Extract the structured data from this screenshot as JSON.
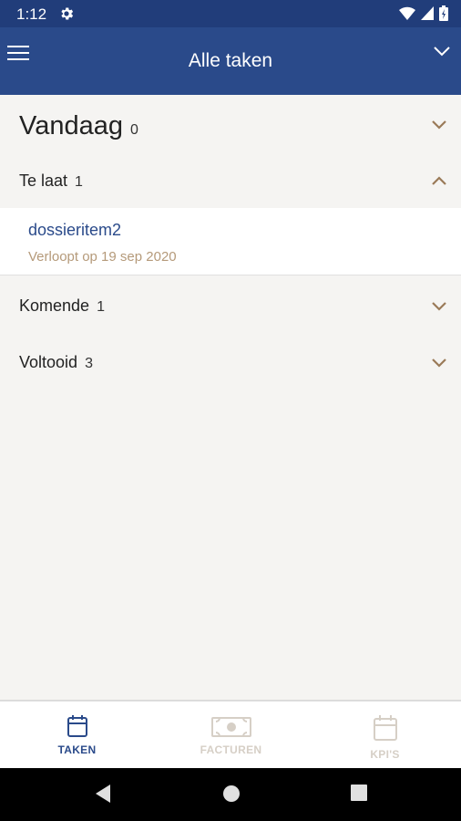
{
  "status_bar": {
    "time": "1:12"
  },
  "app_bar": {
    "title": "Alle taken"
  },
  "sections": {
    "today": {
      "label": "Vandaag",
      "count": "0"
    },
    "overdue": {
      "label": "Te laat",
      "count": "1"
    },
    "upcoming": {
      "label": "Komende",
      "count": "1"
    },
    "completed": {
      "label": "Voltooid",
      "count": "3"
    }
  },
  "task": {
    "name": "dossieritem2",
    "due": "Verloopt op 19 sep 2020"
  },
  "bottom_nav": [
    {
      "label": "TAKEN",
      "icon": "calendar-icon",
      "active": true
    },
    {
      "label": "FACTUREN",
      "icon": "banknote-icon",
      "active": false
    },
    {
      "label": "KPI'S",
      "icon": "calendar-icon",
      "active": false
    }
  ],
  "colors": {
    "status_bar": "#213d7a",
    "app_bar": "#2a4a8a",
    "accent": "#2a4a8a",
    "chevron": "#9a7a58",
    "due_text": "#b59a7a",
    "inactive_nav": "#d6cfc6"
  }
}
